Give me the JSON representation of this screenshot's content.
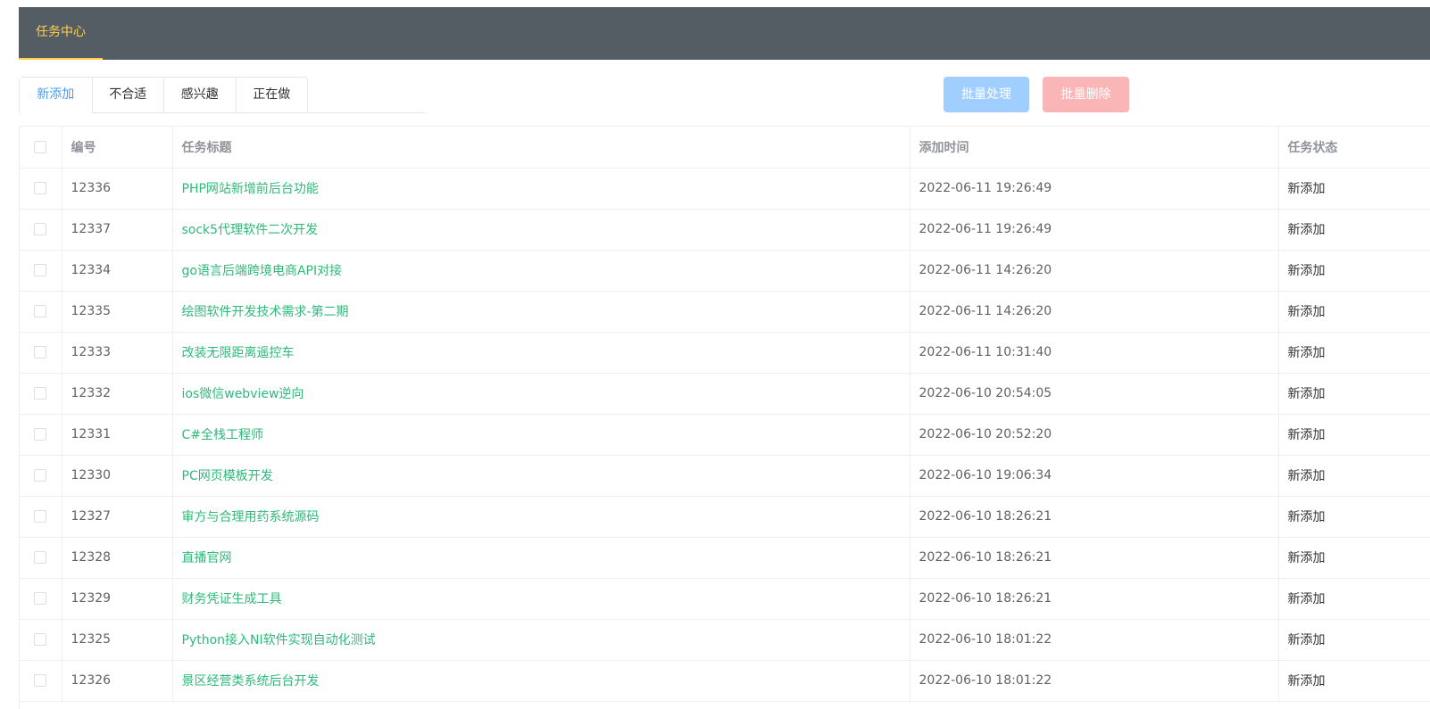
{
  "header": {
    "active_tab": "任务中心"
  },
  "tabs": [
    {
      "label": "新添加",
      "active": true
    },
    {
      "label": "不合适",
      "active": false
    },
    {
      "label": "感兴趣",
      "active": false
    },
    {
      "label": "正在做",
      "active": false
    }
  ],
  "actions": {
    "batch_process": "批量处理",
    "batch_delete": "批量删除"
  },
  "table": {
    "headers": {
      "id": "编号",
      "title": "任务标题",
      "time": "添加时间",
      "status": "任务状态"
    },
    "rows": [
      {
        "id": "12336",
        "title": "PHP网站新增前后台功能",
        "time": "2022-06-11 19:26:49",
        "status": "新添加"
      },
      {
        "id": "12337",
        "title": "sock5代理软件二次开发",
        "time": "2022-06-11 19:26:49",
        "status": "新添加"
      },
      {
        "id": "12334",
        "title": "go语言后端跨境电商API对接",
        "time": "2022-06-11 14:26:20",
        "status": "新添加"
      },
      {
        "id": "12335",
        "title": "绘图软件开发技术需求-第二期",
        "time": "2022-06-11 14:26:20",
        "status": "新添加"
      },
      {
        "id": "12333",
        "title": "改装无限距离遥控车",
        "time": "2022-06-11 10:31:40",
        "status": "新添加"
      },
      {
        "id": "12332",
        "title": "ios微信webview逆向",
        "time": "2022-06-10 20:54:05",
        "status": "新添加"
      },
      {
        "id": "12331",
        "title": "C#全栈工程师",
        "time": "2022-06-10 20:52:20",
        "status": "新添加"
      },
      {
        "id": "12330",
        "title": "PC网页模板开发",
        "time": "2022-06-10 19:06:34",
        "status": "新添加"
      },
      {
        "id": "12327",
        "title": "审方与合理用药系统源码",
        "time": "2022-06-10 18:26:21",
        "status": "新添加"
      },
      {
        "id": "12328",
        "title": "直播官网",
        "time": "2022-06-10 18:26:21",
        "status": "新添加"
      },
      {
        "id": "12329",
        "title": "财务凭证生成工具",
        "time": "2022-06-10 18:26:21",
        "status": "新添加"
      },
      {
        "id": "12325",
        "title": "Python接入NI软件实现自动化测试",
        "time": "2022-06-10 18:01:22",
        "status": "新添加"
      },
      {
        "id": "12326",
        "title": "景区经营类系统后台开发",
        "time": "2022-06-10 18:01:22",
        "status": "新添加"
      }
    ]
  },
  "colors": {
    "header_bg": "#545c64",
    "header_active": "#ffd04b",
    "tab_active": "#409eff",
    "link_green": "#2fb87a",
    "primary_disabled": "#a0cfff",
    "danger_disabled": "#fab6b6"
  }
}
